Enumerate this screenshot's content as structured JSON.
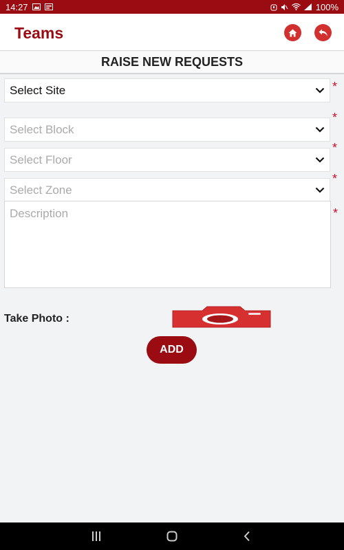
{
  "status_bar": {
    "time": "14:27",
    "battery": "100%"
  },
  "app_bar": {
    "title": "Teams",
    "home_icon": "home-icon",
    "back_icon": "reply-icon"
  },
  "section_title": "RAISE NEW REQUESTS",
  "form": {
    "site": {
      "value": "Select Site",
      "required_mark": "*"
    },
    "block": {
      "placeholder": "Select Block",
      "required_mark": "*"
    },
    "floor": {
      "placeholder": "Select Floor",
      "required_mark": "*"
    },
    "zone": {
      "placeholder": "Select Zone",
      "required_mark": "*"
    },
    "description": {
      "placeholder": "Description",
      "required_mark": "*"
    }
  },
  "photo": {
    "label": "Take Photo :",
    "icon": "camera-icon"
  },
  "add_button": "ADD",
  "colors": {
    "brand": "#9b0b12",
    "accent": "#d22f2f",
    "required": "#c8102e"
  }
}
